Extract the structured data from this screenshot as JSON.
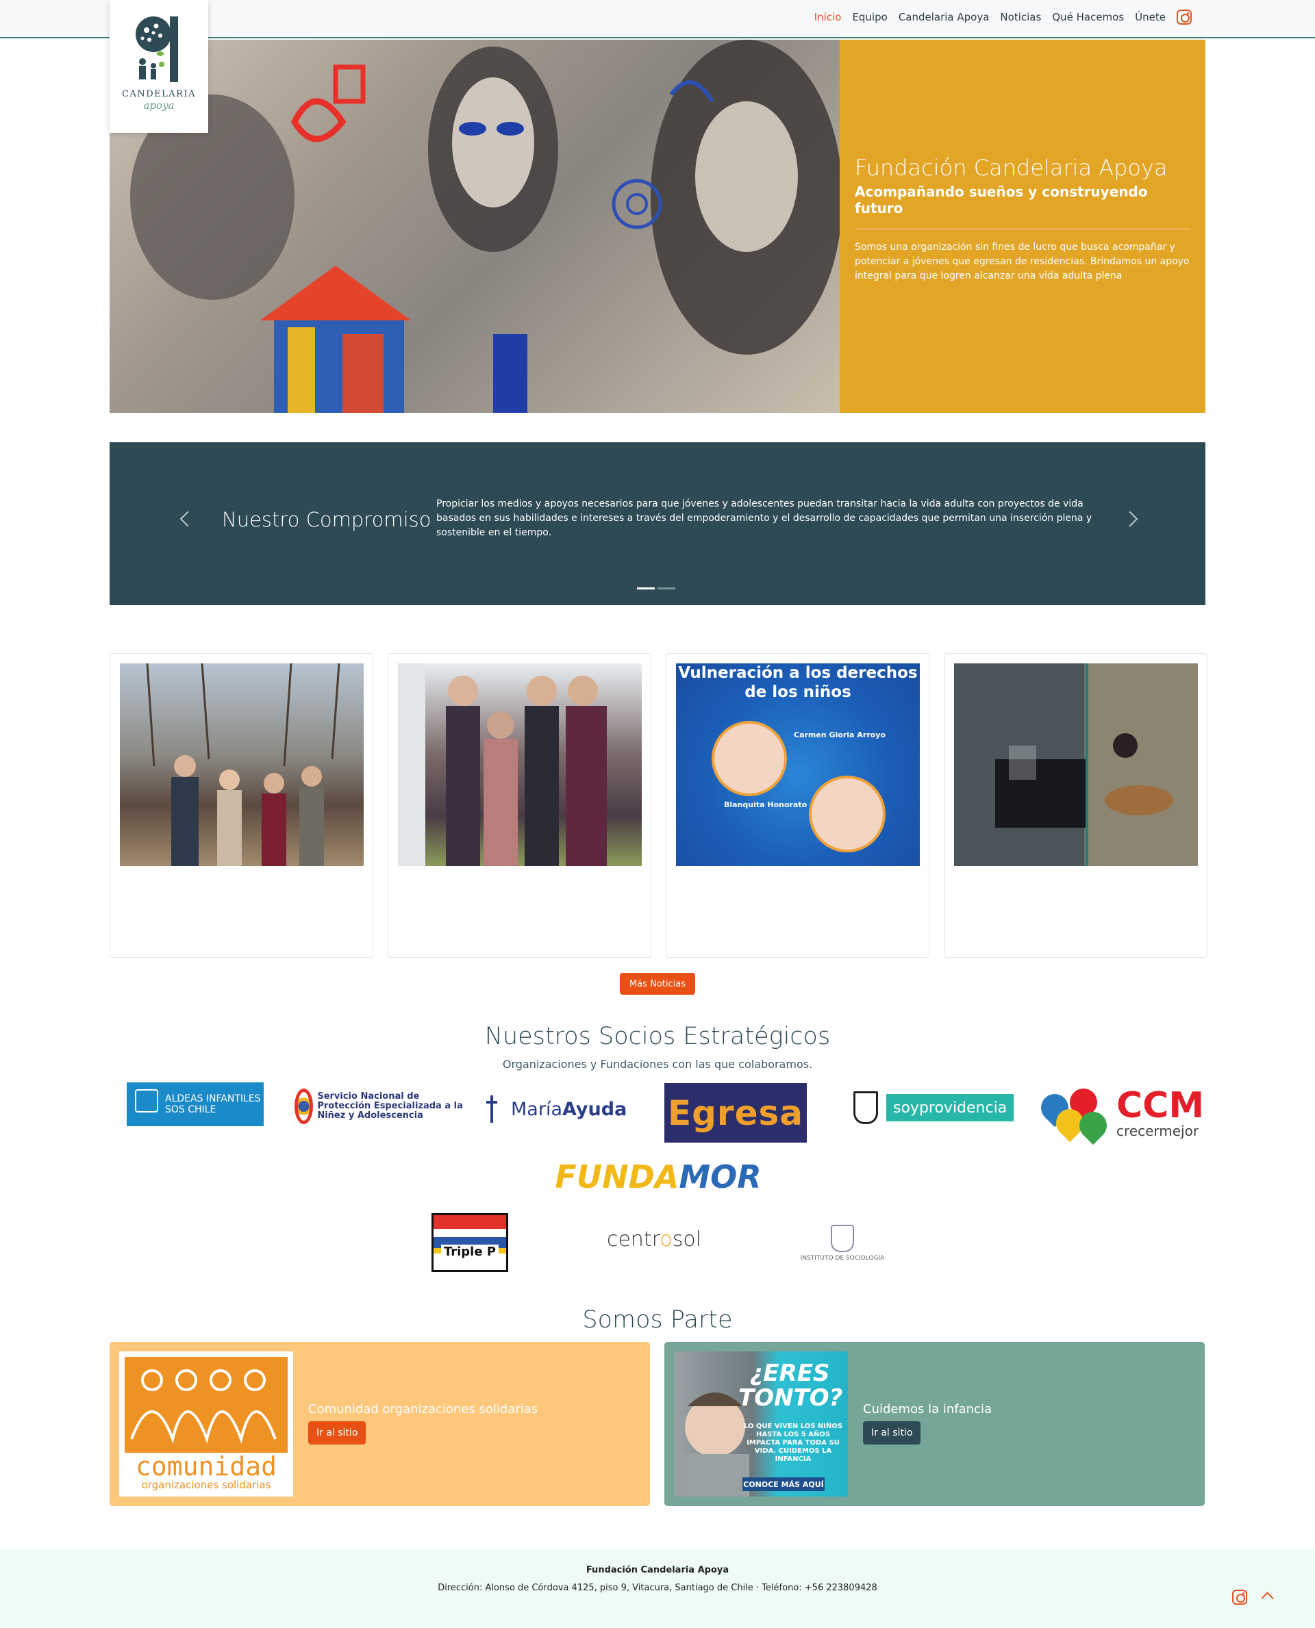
{
  "nav": {
    "items": [
      {
        "label": "Inicio"
      },
      {
        "label": "Equipo"
      },
      {
        "label": "Candelaria Apoya"
      },
      {
        "label": "Noticias"
      },
      {
        "label": "Qué Hacemos"
      },
      {
        "label": "Únete"
      }
    ],
    "active": "Inicio",
    "icon": "instagram-icon"
  },
  "logo": {
    "name": "CANDELARIA",
    "sub": "apoya"
  },
  "hero": {
    "title": "Fundación Candelaria Apoya",
    "subtitle": "Acompañando sueños y construyendo futuro",
    "text": "Somos una organización sin fines de lucro que busca acompañar y potenciar a jóvenes que egresan de residencias. Brindamos un apoyo integral para que logren alcanzar una vida adulta plena"
  },
  "commitment": {
    "title": "Nuestro Compromiso",
    "text": "Propiciar los medios y apoyos necesarios para que jóvenes y adolescentes puedan transitar hacia la vida adulta con proyectos de vida basados en sus habilidades e intereses a través del empoderamiento y el desarrollo de capacidades que permitan una inserción plena y sostenible en el tiempo.",
    "slide_count": 2,
    "active_slide": 1
  },
  "news": {
    "card3": {
      "title": "Vulneración a los derechos de los niños",
      "person1": "Carmen Gloria Arroyo",
      "person2": "Blanquita Honorato"
    },
    "more_label": "Más Noticias"
  },
  "partners": {
    "title": "Nuestros Socios Estratégicos",
    "subtitle": "Organizaciones y Fundaciones con las que colaboramos.",
    "aldeas": "ALDEAS INFANTILES SOS CHILE",
    "servicio": "Servicio Nacional de Protección Especializada a la Niñez y Adolescencia",
    "maria_a": "María",
    "maria_b": "Ayuda",
    "egresa": "Egresa",
    "soy": "soyprovidencia",
    "ccm": "CCM",
    "ccm_sub": "crecermejor",
    "fundamor_a": "FUNDA",
    "fundamor_b": "MOR",
    "triplep": "Triple P",
    "centro_a": "centr",
    "centro_b": "o",
    "centro_c": "sol",
    "sociologia": "INSTITUTO DE SOCIOLOGÍA"
  },
  "somos": {
    "title": "Somos Parte",
    "card1": {
      "label": "Comunidad organizaciones solidarias",
      "button": "Ir al sitio",
      "logo_word": "comunidad",
      "logo_sub": "organizaciones solidarias"
    },
    "card2": {
      "label": "Cuidemos la infancia",
      "button": "Ir al sitio",
      "poster_big": "¿ERES TONTO?",
      "poster_small": "LO QUE VIVEN LOS NIÑOS HASTA LOS 5 AÑOS IMPACTA PARA TODA SU VIDA. CUIDEMOS LA INFANCIA",
      "poster_btn": "CONOCE MÁS AQUÍ"
    }
  },
  "footer": {
    "name": "Fundación Candelaria Apoya",
    "address": "Dirección: Alonso de Córdova 4125, piso 9, Vitacura, Santiago de Chile · Teléfono: +56 223809428"
  },
  "colors": {
    "accent": "#e65324",
    "hero_panel": "#e2a526",
    "dark": "#2d4a55",
    "partner1_bg": "#fdc77c",
    "partner2_bg": "#75a698",
    "footer_bg": "#effcf6"
  }
}
